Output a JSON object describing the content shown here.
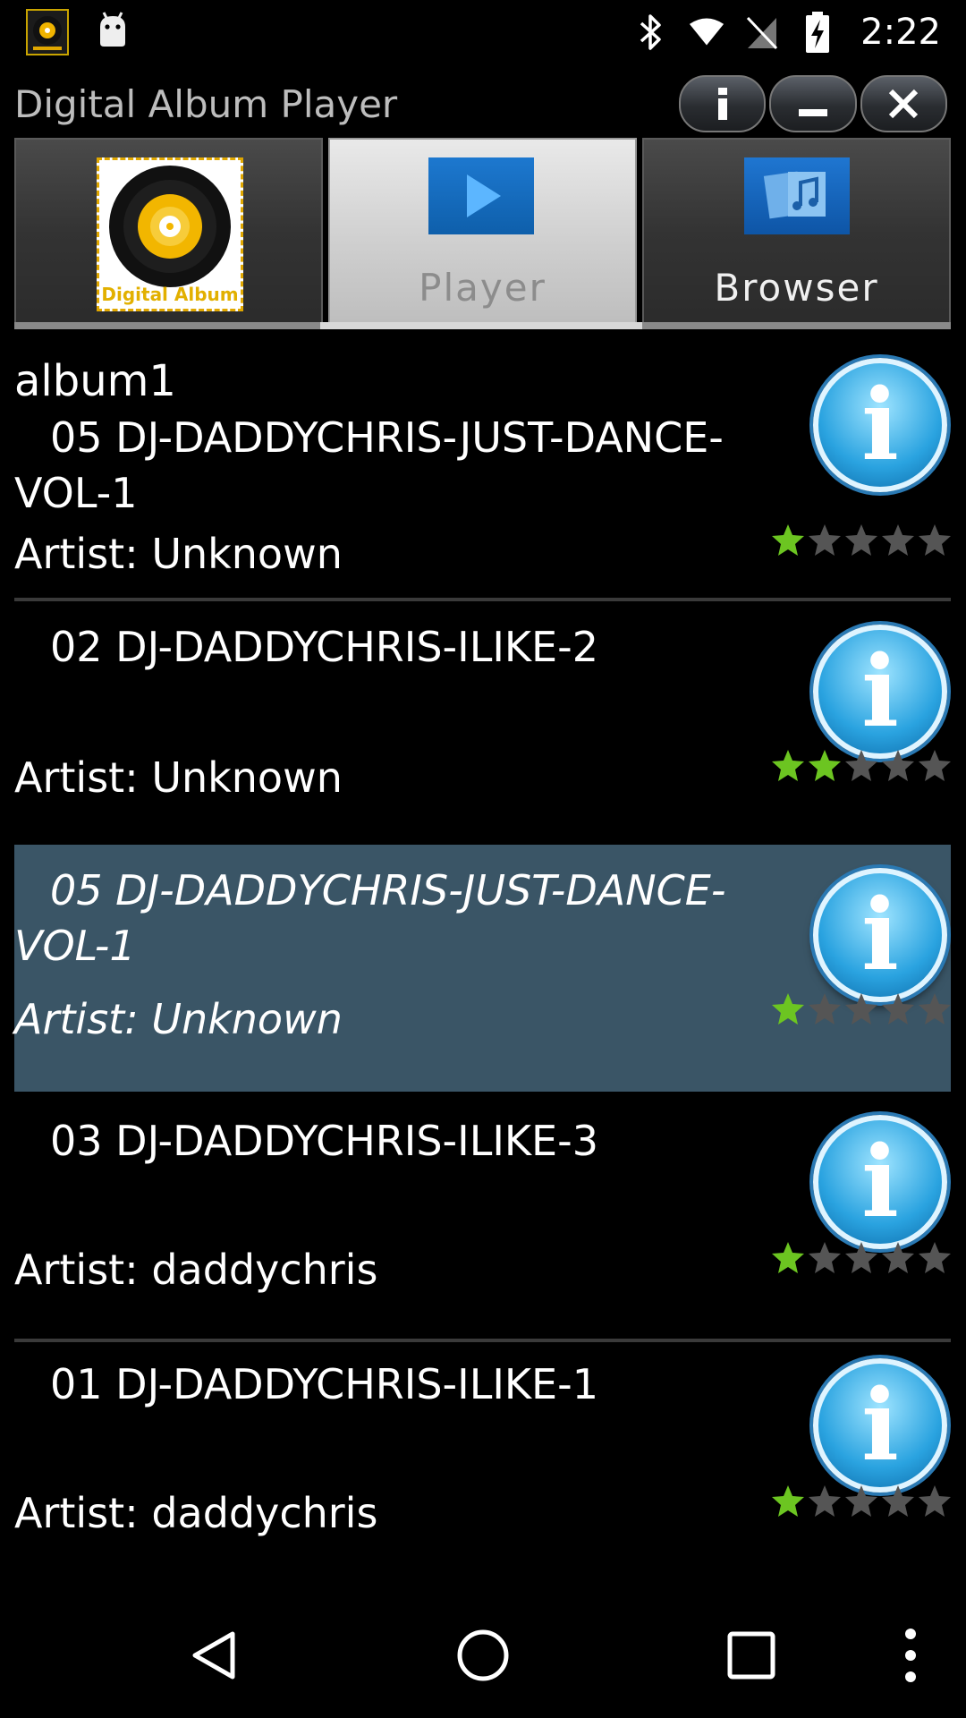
{
  "status_bar": {
    "time": "2:22",
    "icons": [
      "app-notification-icon",
      "android-icon",
      "bluetooth-icon",
      "wifi-icon",
      "no-sim-icon",
      "battery-charging-icon"
    ]
  },
  "title_bar": {
    "title": "Digital Album Player",
    "buttons": [
      "info-icon",
      "minimize-icon",
      "close-icon"
    ]
  },
  "tabs": {
    "logo_text": "Digital Album",
    "player_label": "Player",
    "browser_label": "Browser",
    "active": "Player"
  },
  "list": {
    "items": [
      {
        "album": "album1",
        "track": "05 DJ-DADDYCHRIS-JUST-DANCE-VOL-1",
        "artist": "Artist: Unknown",
        "rating": 1,
        "selected": false
      },
      {
        "album": "",
        "track": "02 DJ-DADDYCHRIS-ILIKE-2",
        "artist": "Artist: Unknown",
        "rating": 2,
        "selected": false
      },
      {
        "album": "",
        "track": "05 DJ-DADDYCHRIS-JUST-DANCE-VOL-1",
        "artist": "Artist: Unknown",
        "rating": 1,
        "selected": true
      },
      {
        "album": "",
        "track": "03 DJ-DADDYCHRIS-ILIKE-3",
        "artist": "Artist: daddychris",
        "rating": 1,
        "selected": false
      },
      {
        "album": "",
        "track": "01 DJ-DADDYCHRIS-ILIKE-1",
        "artist": "Artist: daddychris",
        "rating": 1,
        "selected": false
      }
    ]
  },
  "colors": {
    "selected_row": "#3a5566",
    "star_on": "#6cc521",
    "star_off": "#555555"
  },
  "nav_bar": {
    "buttons": [
      "back-icon",
      "home-icon",
      "recents-icon",
      "overflow-menu-icon"
    ]
  }
}
